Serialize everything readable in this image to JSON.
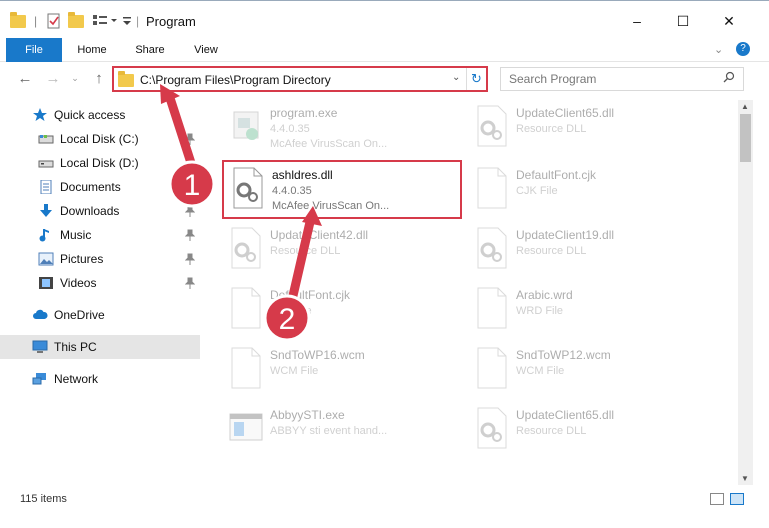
{
  "window": {
    "title": "Program",
    "minimize": "–",
    "maximize": "☐",
    "close": "✕"
  },
  "ribbon": {
    "tabs": [
      "File",
      "Home",
      "Share",
      "View"
    ]
  },
  "address": {
    "path": "C:\\Program Files\\Program Directory"
  },
  "search": {
    "placeholder": "Search Program"
  },
  "sidebar": {
    "items": [
      {
        "label": "Quick access",
        "icon": "star-icon"
      },
      {
        "label": "Local Disk (C:)",
        "icon": "drive-icon",
        "pinned": true
      },
      {
        "label": "Local Disk (D:)",
        "icon": "drive-icon"
      },
      {
        "label": "Documents",
        "icon": "documents-icon",
        "pinned": true
      },
      {
        "label": "Downloads",
        "icon": "download-icon",
        "pinned": true
      },
      {
        "label": "Music",
        "icon": "music-icon",
        "pinned": true
      },
      {
        "label": "Pictures",
        "icon": "pictures-icon",
        "pinned": true
      },
      {
        "label": "Videos",
        "icon": "videos-icon",
        "pinned": true
      },
      {
        "label": "OneDrive",
        "icon": "cloud-icon"
      },
      {
        "label": "This PC",
        "icon": "computer-icon",
        "selected": true
      },
      {
        "label": "Network",
        "icon": "network-icon"
      }
    ]
  },
  "files": [
    {
      "name": "program.exe",
      "line2": "4.4.0.35",
      "line3": "McAfee VirusScan On...",
      "icon": "exe-icon"
    },
    {
      "name": "UpdateClient65.dll",
      "line2": "Resource DLL",
      "line3": "",
      "icon": "dll-gear-icon"
    },
    {
      "name": "ashldres.dll",
      "line2": "4.4.0.35",
      "line3": "McAfee VirusScan On...",
      "icon": "dll-gear-icon",
      "highlighted": true
    },
    {
      "name": "DefaultFont.cjk",
      "line2": "CJK File",
      "line3": "",
      "icon": "blank-file-icon"
    },
    {
      "name": "UpdateClient42.dll",
      "line2": "Resource DLL",
      "line3": "",
      "icon": "dll-gear-icon"
    },
    {
      "name": "UpdateClient19.dll",
      "line2": "Resource DLL",
      "line3": "",
      "icon": "dll-gear-icon"
    },
    {
      "name": "DefaultFont.cjk",
      "line2": "CJK File",
      "line3": "",
      "icon": "blank-file-icon"
    },
    {
      "name": "Arabic.wrd",
      "line2": "WRD File",
      "line3": "",
      "icon": "blank-file-icon"
    },
    {
      "name": "SndToWP16.wcm",
      "line2": "WCM File",
      "line3": "",
      "icon": "blank-file-icon"
    },
    {
      "name": "SndToWP12.wcm",
      "line2": "WCM File",
      "line3": "",
      "icon": "blank-file-icon"
    },
    {
      "name": "AbbyySTI.exe",
      "line2": "ABBYY sti event hand...",
      "line3": "",
      "icon": "exe-window-icon"
    },
    {
      "name": "UpdateClient65.dll",
      "line2": "Resource DLL",
      "line3": "",
      "icon": "dll-gear-icon"
    }
  ],
  "status": {
    "items_count": "115 items"
  },
  "annotations": {
    "badge1": "1",
    "badge2": "2",
    "accent_color": "#d63a4a"
  },
  "colors": {
    "file_tab": "#1979ca",
    "selection": "#e5e5e5"
  }
}
